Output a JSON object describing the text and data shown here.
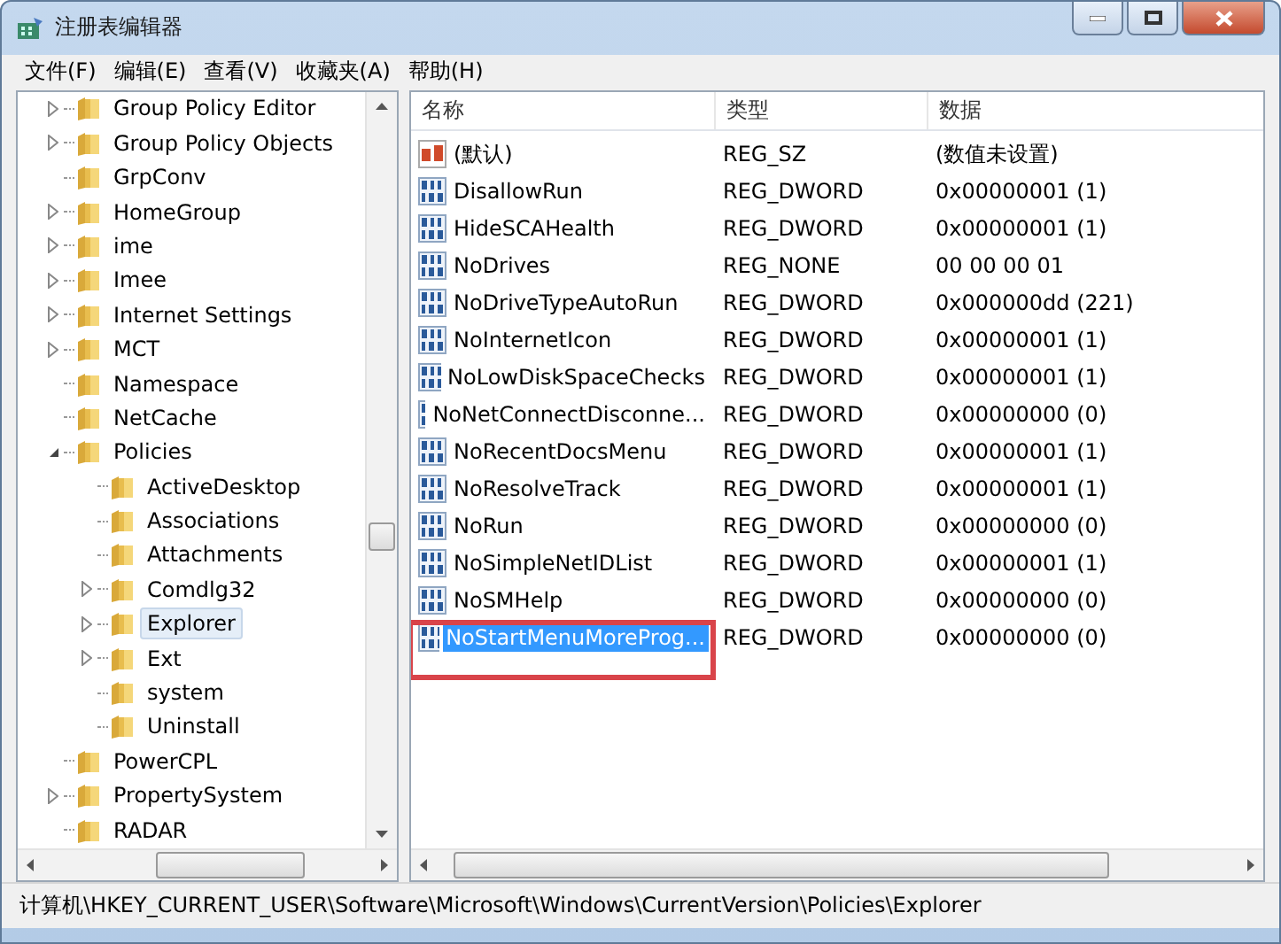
{
  "window": {
    "title": "注册表编辑器"
  },
  "menu": [
    "文件(F)",
    "编辑(E)",
    "查看(V)",
    "收藏夹(A)",
    "帮助(H)"
  ],
  "tree": [
    {
      "label": "Group Policy Editor",
      "expanded": false,
      "selected": false
    },
    {
      "label": "Group Policy Objects",
      "expanded": false,
      "selected": false
    },
    {
      "label": "GrpConv",
      "selected": false
    },
    {
      "label": "HomeGroup",
      "expanded": false,
      "selected": false
    },
    {
      "label": "ime",
      "expanded": false,
      "selected": false
    },
    {
      "label": "Imee",
      "expanded": false,
      "selected": false
    },
    {
      "label": "Internet Settings",
      "expanded": false,
      "selected": false
    },
    {
      "label": "MCT",
      "expanded": false,
      "selected": false
    },
    {
      "label": "Namespace",
      "selected": false
    },
    {
      "label": "NetCache",
      "selected": false
    },
    {
      "label": "Policies",
      "expanded": true,
      "selected": false,
      "children": [
        {
          "label": "ActiveDesktop",
          "selected": false
        },
        {
          "label": "Associations",
          "selected": false
        },
        {
          "label": "Attachments",
          "selected": false
        },
        {
          "label": "Comdlg32",
          "expanded": false,
          "selected": false
        },
        {
          "label": "Explorer",
          "expanded": false,
          "selected": true
        },
        {
          "label": "Ext",
          "expanded": false,
          "selected": false
        },
        {
          "label": "system",
          "selected": false
        },
        {
          "label": "Uninstall",
          "selected": false
        }
      ]
    },
    {
      "label": "PowerCPL",
      "selected": false
    },
    {
      "label": "PropertySystem",
      "expanded": false,
      "selected": false
    },
    {
      "label": "RADAR",
      "selected": false
    }
  ],
  "table": {
    "columns": [
      "名称",
      "类型",
      "数据"
    ],
    "rows": [
      {
        "kind": "string",
        "name": "(默认)",
        "type": "REG_SZ",
        "data": "(数值未设置)",
        "selected": false,
        "highlighted": false
      },
      {
        "kind": "binary",
        "name": "DisallowRun",
        "type": "REG_DWORD",
        "data": "0x00000001 (1)",
        "selected": false,
        "highlighted": false
      },
      {
        "kind": "binary",
        "name": "HideSCAHealth",
        "type": "REG_DWORD",
        "data": "0x00000001 (1)",
        "selected": false,
        "highlighted": false
      },
      {
        "kind": "binary",
        "name": "NoDrives",
        "type": "REG_NONE",
        "data": "00 00 00 01",
        "selected": false,
        "highlighted": false
      },
      {
        "kind": "binary",
        "name": "NoDriveTypeAutoRun",
        "type": "REG_DWORD",
        "data": "0x000000dd (221)",
        "selected": false,
        "highlighted": false
      },
      {
        "kind": "binary",
        "name": "NoInternetIcon",
        "type": "REG_DWORD",
        "data": "0x00000001 (1)",
        "selected": false,
        "highlighted": false
      },
      {
        "kind": "binary",
        "name": "NoLowDiskSpaceChecks",
        "type": "REG_DWORD",
        "data": "0x00000001 (1)",
        "selected": false,
        "highlighted": false
      },
      {
        "kind": "binary",
        "name": "NoNetConnectDisconne...",
        "type": "REG_DWORD",
        "data": "0x00000000 (0)",
        "selected": false,
        "highlighted": false
      },
      {
        "kind": "binary",
        "name": "NoRecentDocsMenu",
        "type": "REG_DWORD",
        "data": "0x00000001 (1)",
        "selected": false,
        "highlighted": false
      },
      {
        "kind": "binary",
        "name": "NoResolveTrack",
        "type": "REG_DWORD",
        "data": "0x00000001 (1)",
        "selected": false,
        "highlighted": false
      },
      {
        "kind": "binary",
        "name": "NoRun",
        "type": "REG_DWORD",
        "data": "0x00000000 (0)",
        "selected": false,
        "highlighted": false
      },
      {
        "kind": "binary",
        "name": "NoSimpleNetIDList",
        "type": "REG_DWORD",
        "data": "0x00000001 (1)",
        "selected": false,
        "highlighted": false
      },
      {
        "kind": "binary",
        "name": "NoSMHelp",
        "type": "REG_DWORD",
        "data": "0x00000000 (0)",
        "selected": false,
        "highlighted": false
      },
      {
        "kind": "binary",
        "name": "NoStartMenuMoreProg...",
        "type": "REG_DWORD",
        "data": "0x00000000 (0)",
        "selected": true,
        "highlighted": true
      }
    ]
  },
  "status_bar": "计算机\\HKEY_CURRENT_USER\\Software\\Microsoft\\Windows\\CurrentVersion\\Policies\\Explorer"
}
